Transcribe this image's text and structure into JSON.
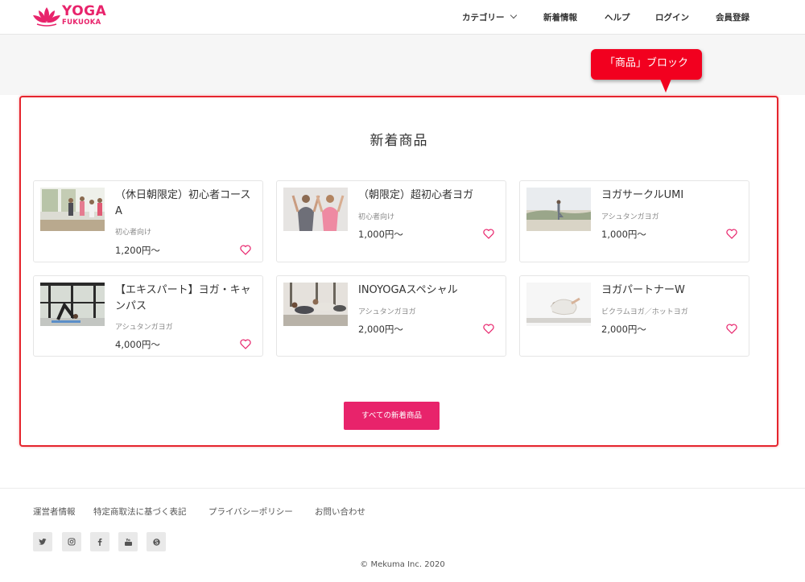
{
  "brand": {
    "line1": "YOGA",
    "line2": "FUKUOKA",
    "color": "#e8236b"
  },
  "nav": {
    "category": "カテゴリー",
    "news": "新着情報",
    "help": "ヘルプ",
    "login": "ログイン",
    "register": "会員登録"
  },
  "callout": {
    "text": "「商品」ブロック"
  },
  "section": {
    "title": "新着商品"
  },
  "products": [
    {
      "title": "（休日朝限定）初心者コースA",
      "category": "初心者向け",
      "price": "1,200円〜"
    },
    {
      "title": "（朝限定）超初心者ヨガ",
      "category": "初心者向け",
      "price": "1,000円〜"
    },
    {
      "title": "ヨガサークルUMI",
      "category": "アシュタンガヨガ",
      "price": "1,000円〜"
    },
    {
      "title": "【エキスパート】ヨガ・キャンパス",
      "category": "アシュタンガヨガ",
      "price": "4,000円〜"
    },
    {
      "title": "INOYOGAスペシャル",
      "category": "アシュタンガヨガ",
      "price": "2,000円〜"
    },
    {
      "title": "ヨガパートナーW",
      "category": "ビクラムヨガ／ホットヨガ",
      "price": "2,000円〜"
    }
  ],
  "all_button": "すべての新着商品",
  "footer": {
    "links": [
      "運営者情報",
      "特定商取法に基づく表記",
      "プライバシーポリシー",
      "お問い合わせ"
    ],
    "social_icons": [
      "twitter-icon",
      "instagram-icon",
      "facebook-icon",
      "youtube-icon",
      "skype-icon"
    ],
    "copyright": "© Mekuma Inc. 2020"
  },
  "colors": {
    "accent": "#e8236b",
    "frame": "#e5252e",
    "callout": "#f2001f"
  }
}
